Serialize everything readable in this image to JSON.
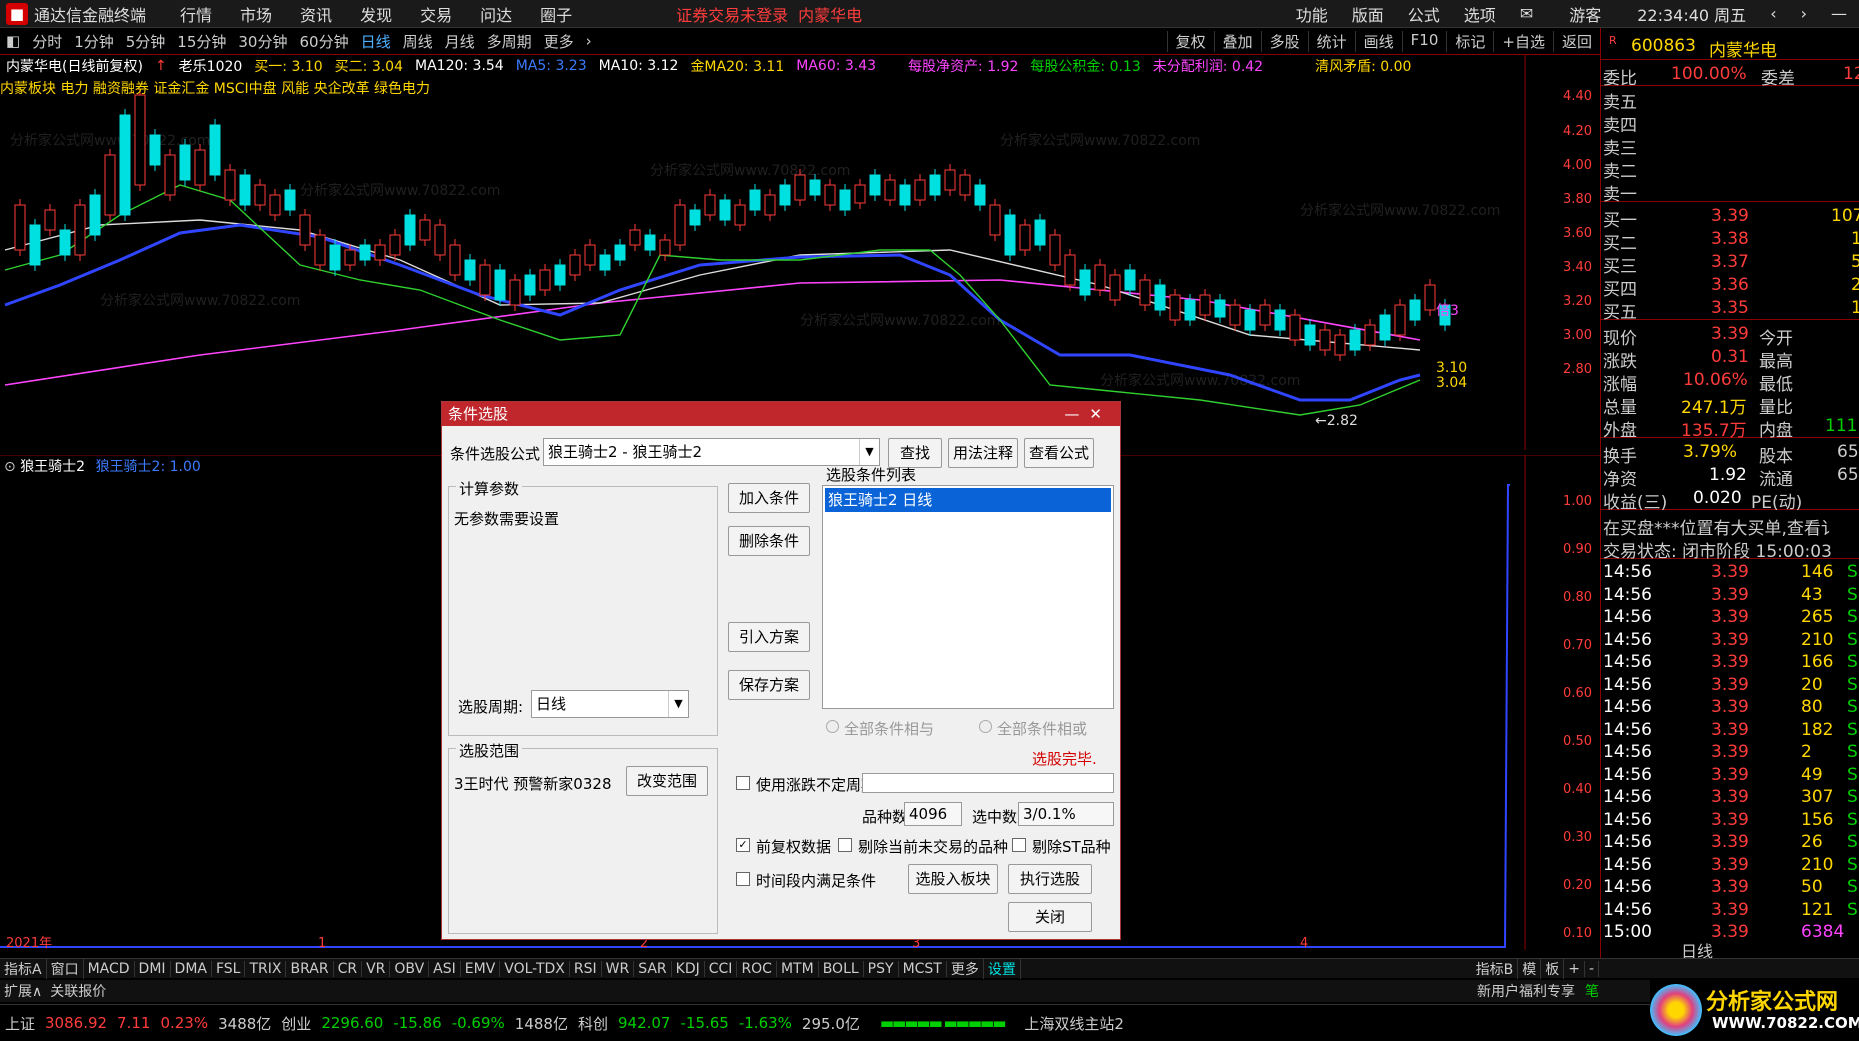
{
  "menubar": {
    "app_title": "通达信金融终端",
    "items": [
      "行情",
      "市场",
      "资讯",
      "发现",
      "交易",
      "问达",
      "圈子"
    ],
    "warning": "证券交易未登录",
    "stock_name": "内蒙华电",
    "right_items": [
      "功能",
      "版面",
      "公式",
      "选项"
    ],
    "user": "游客",
    "time": "22:34:40 周五"
  },
  "periods": [
    "分时",
    "1分钟",
    "5分钟",
    "15分钟",
    "30分钟",
    "60分钟",
    "日线",
    "周线",
    "月线",
    "多周期",
    "更多"
  ],
  "active_period": "日线",
  "tools": [
    "复权",
    "叠加",
    "多股",
    "统计",
    "画线",
    "F10",
    "标记",
    "+自选",
    "返回"
  ],
  "quote_info": {
    "title": "内蒙华电(日线前复权)",
    "teacher": "老乐1020",
    "buy1": "买一: 3.10",
    "buy2": "买二: 3.04",
    "ma120": "MA120: 3.54",
    "ma5": "MA5: 3.23",
    "ma10": "MA10: 3.12",
    "ma20": "金MA20: 3.11",
    "ma60": "MA60: 3.43",
    "nav": "每股净资产: 1.92",
    "fund": "每股公积金: 0.13",
    "profit": "未分配利润: 0.42",
    "clear": "清风矛盾: 0.00"
  },
  "concepts": "内蒙板块 电力 融资融券 证金汇金 MSCI中盘 风能 央企改革 绿色电力",
  "sub_title": "狼王骑士2",
  "sub_value": "狼王骑士2: 1.00",
  "chart_labels": {
    "low": "←2.82",
    "r1": "3.10",
    "r2": "3.04",
    "bei3": "倍3"
  },
  "price_axis": [
    "4.40",
    "4.20",
    "4.00",
    "3.80",
    "3.60",
    "3.40",
    "3.20",
    "3.00",
    "2.80"
  ],
  "sub_axis": [
    "1.00",
    "0.90",
    "0.80",
    "0.70",
    "0.60",
    "0.50",
    "0.40",
    "0.30",
    "0.20",
    "0.10"
  ],
  "time_axis": {
    "year": "2021年",
    "m1": "1",
    "m2": "2",
    "m3": "3",
    "m4": "4"
  },
  "watermark": "分析家公式网www.70822.com",
  "right_panel": {
    "code": "600863",
    "name": "内蒙华电",
    "wei_bi_label": "委比",
    "wei_bi": "100.00%",
    "wei_cha_label": "委差",
    "wei_cha": "12",
    "sell": [
      "卖五",
      "卖四",
      "卖三",
      "卖二",
      "卖一"
    ],
    "buy": [
      {
        "label": "买一",
        "price": "3.39",
        "vol": "107"
      },
      {
        "label": "买二",
        "price": "3.38",
        "vol": "1"
      },
      {
        "label": "买三",
        "price": "3.37",
        "vol": "5"
      },
      {
        "label": "买四",
        "price": "3.36",
        "vol": "2"
      },
      {
        "label": "买五",
        "price": "3.35",
        "vol": "1"
      }
    ],
    "stats": [
      {
        "l1": "现价",
        "v1": "3.39",
        "l2": "今开",
        "v2": ""
      },
      {
        "l1": "涨跌",
        "v1": "0.31",
        "l2": "最高",
        "v2": ""
      },
      {
        "l1": "涨幅",
        "v1": "10.06%",
        "l2": "最低",
        "v2": ""
      },
      {
        "l1": "总量",
        "v1": "247.1万",
        "l2": "量比",
        "v2": ""
      },
      {
        "l1": "外盘",
        "v1": "135.7万",
        "l2": "内盘",
        "v2": "111"
      }
    ],
    "stats2": [
      {
        "l1": "换手",
        "v1": "3.79%",
        "l2": "股本",
        "v2": "65"
      },
      {
        "l1": "净资",
        "v1": "1.92",
        "l2": "流通",
        "v2": "65"
      },
      {
        "l1": "收益(三)",
        "v1": "0.020",
        "l2": "PE(动)",
        "v2": ""
      }
    ],
    "notice": "在买盘***位置有大买单,查看讠",
    "trade_status": "交易状态: 闭市阶段 15:00:03",
    "ticks": [
      {
        "t": "14:56",
        "p": "3.39",
        "v": "146",
        "s": "S"
      },
      {
        "t": "14:56",
        "p": "3.39",
        "v": "43",
        "s": "S"
      },
      {
        "t": "14:56",
        "p": "3.39",
        "v": "265",
        "s": "S"
      },
      {
        "t": "14:56",
        "p": "3.39",
        "v": "210",
        "s": "S"
      },
      {
        "t": "14:56",
        "p": "3.39",
        "v": "166",
        "s": "S"
      },
      {
        "t": "14:56",
        "p": "3.39",
        "v": "20",
        "s": "S"
      },
      {
        "t": "14:56",
        "p": "3.39",
        "v": "80",
        "s": "S"
      },
      {
        "t": "14:56",
        "p": "3.39",
        "v": "182",
        "s": "S"
      },
      {
        "t": "14:56",
        "p": "3.39",
        "v": "2",
        "s": "S"
      },
      {
        "t": "14:56",
        "p": "3.39",
        "v": "49",
        "s": "S"
      },
      {
        "t": "14:56",
        "p": "3.39",
        "v": "307",
        "s": "S"
      },
      {
        "t": "14:56",
        "p": "3.39",
        "v": "156",
        "s": "S"
      },
      {
        "t": "14:56",
        "p": "3.39",
        "v": "26",
        "s": "S"
      },
      {
        "t": "14:56",
        "p": "3.39",
        "v": "210",
        "s": "S"
      },
      {
        "t": "14:56",
        "p": "3.39",
        "v": "50",
        "s": "S"
      },
      {
        "t": "14:56",
        "p": "3.39",
        "v": "121",
        "s": "S"
      },
      {
        "t": "15:00",
        "p": "3.39",
        "v": "6384",
        "s": ""
      }
    ],
    "period_tag": "日线"
  },
  "bottom_tabs": [
    "指标A",
    "窗口",
    "MACD",
    "DMI",
    "DMA",
    "FSL",
    "TRIX",
    "BRAR",
    "CR",
    "VR",
    "OBV",
    "ASI",
    "EMV",
    "VOL-TDX",
    "RSI",
    "WR",
    "SAR",
    "KDJ",
    "CCI",
    "ROC",
    "MTM",
    "BOLL",
    "PSY",
    "MCST",
    "更多",
    "设置"
  ],
  "bottom_right": [
    "指标B",
    "模",
    "板",
    "+",
    "-"
  ],
  "ext": {
    "a": "扩展∧",
    "b": "关联报价",
    "promo": "新用户福利专享",
    "pen": "笔"
  },
  "status": {
    "sh": "上证",
    "sh_val": "3086.92",
    "sh_chg": "7.11",
    "sh_pct": "0.23%",
    "sh_amt": "3488亿",
    "cy": "创业",
    "cy_val": "2296.60",
    "cy_chg": "-15.86",
    "cy_pct": "-0.69%",
    "cy_amt": "1488亿",
    "kc": "科创",
    "kc_val": "942.07",
    "kc_chg": "-15.65",
    "kc_pct": "-1.63%",
    "kc_amt": "295.0亿",
    "server": "上海双线主站2"
  },
  "site_logo": {
    "name": "分析家公式网",
    "url": "WWW.70822.COM"
  },
  "dialog": {
    "title": "条件选股",
    "formula_label": "条件选股公式",
    "formula_value": "狼王骑士2  - 狼王骑士2",
    "btn_find": "查找",
    "btn_usage": "用法注释",
    "btn_view": "查看公式",
    "calc_group": "计算参数",
    "no_param": "无参数需要设置",
    "period_label": "选股周期:",
    "period_value": "日线",
    "btn_add": "加入条件",
    "btn_del": "删除条件",
    "btn_import": "引入方案",
    "btn_save": "保存方案",
    "list_label": "选股条件列表",
    "list_item": "狼王骑士2  日线",
    "radio_and": "全部条件相与",
    "radio_or": "全部条件相或",
    "done": "选股完毕.",
    "scope_group": "选股范围",
    "scope_value": "3王时代 预警新家0328",
    "btn_scope": "改变范围",
    "chk_uncertain": "使用涨跌不定周期",
    "count_label": "品种数",
    "count_value": "4096",
    "sel_label": "选中数",
    "sel_value": "3/0.1%",
    "chk_fq": "前复权数据",
    "chk_notrade": "剔除当前未交易的品种",
    "chk_st": "剔除ST品种",
    "chk_range": "时间段内满足条件",
    "btn_toboard": "选股入板块",
    "btn_exec": "执行选股",
    "btn_close": "关闭"
  }
}
